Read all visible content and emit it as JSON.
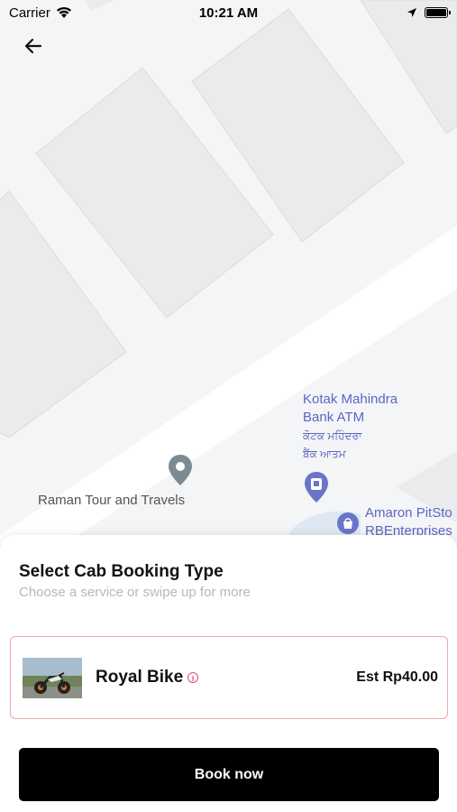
{
  "status_bar": {
    "carrier": "Carrier",
    "time": "10:21 AM"
  },
  "map": {
    "atm_label_line1": "Kotak Mahindra",
    "atm_label_line2": "Bank ATM",
    "atm_label_local1": "ਕੋਟਕ ਮਹਿੰਦਰਾ",
    "atm_label_local2": "ਬੈਂਕ ਆਤਮ",
    "poi_label": "Raman Tour and Travels",
    "amaron_line1": "Amaron PitSto",
    "amaron_line2": "RBEnterprises",
    "accent_color": "#5a66c4"
  },
  "sheet": {
    "title": "Select Cab Booking Type",
    "subtitle": "Choose a service or swipe up for more",
    "cab": {
      "name": "Royal Bike",
      "price": "Est Rp40.00",
      "border_color": "#f3a8a4",
      "info_icon_color": "#e0488b"
    },
    "book_button": "Book now"
  }
}
